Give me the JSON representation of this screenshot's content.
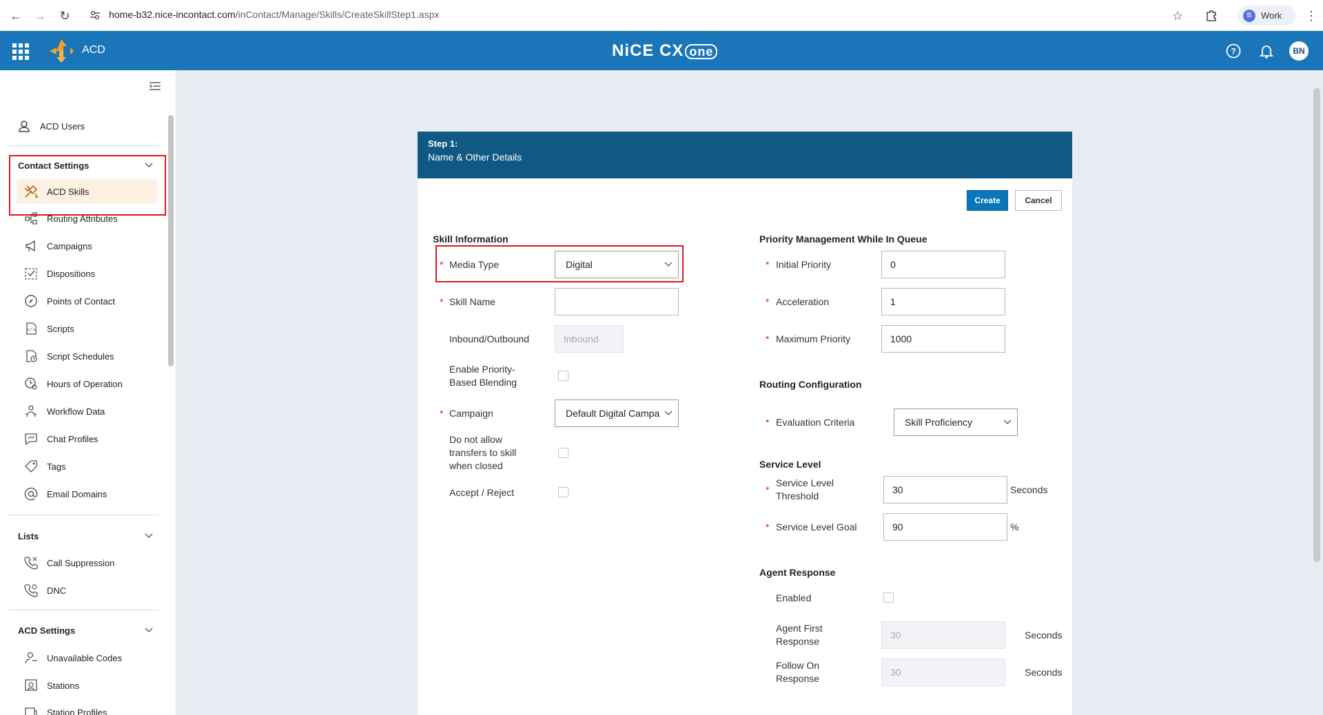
{
  "browser": {
    "url_host": "home-b32.nice-incontact.com",
    "url_path": "/inContact/Manage/Skills/CreateSkillStep1.aspx",
    "profile_initial": "B",
    "profile_label": "Work"
  },
  "header": {
    "app_name": "ACD",
    "brand_main": "NiCE CX",
    "brand_badge": "one",
    "user_initials": "BN"
  },
  "sidebar": {
    "acd_users": "ACD Users",
    "contact_settings": "Contact Settings",
    "items": [
      {
        "label": "ACD Skills",
        "icon": "skills-icon"
      },
      {
        "label": "Routing Attributes",
        "icon": "routing-icon"
      },
      {
        "label": "Campaigns",
        "icon": "megaphone-icon"
      },
      {
        "label": "Dispositions",
        "icon": "dispositions-icon"
      },
      {
        "label": "Points of Contact",
        "icon": "compass-icon"
      },
      {
        "label": "Scripts",
        "icon": "script-icon"
      },
      {
        "label": "Script Schedules",
        "icon": "script-schedule-icon"
      },
      {
        "label": "Hours of Operation",
        "icon": "clock-icon"
      },
      {
        "label": "Workflow Data",
        "icon": "workflow-icon"
      },
      {
        "label": "Chat Profiles",
        "icon": "chat-icon"
      },
      {
        "label": "Tags",
        "icon": "tag-icon"
      },
      {
        "label": "Email Domains",
        "icon": "at-icon"
      }
    ],
    "lists": "Lists",
    "lists_items": [
      {
        "label": "Call Suppression",
        "icon": "phone-off-icon"
      },
      {
        "label": "DNC",
        "icon": "phone-block-icon"
      }
    ],
    "acd_settings": "ACD Settings",
    "acd_settings_items": [
      {
        "label": "Unavailable Codes",
        "icon": "user-code-icon"
      },
      {
        "label": "Stations",
        "icon": "station-icon"
      },
      {
        "label": "Station Profiles",
        "icon": "station-profile-icon"
      }
    ]
  },
  "form": {
    "step": "Step 1:",
    "step_title": "Name & Other Details",
    "create": "Create",
    "cancel": "Cancel",
    "skill_info": {
      "title": "Skill Information",
      "media_type_label": "Media Type",
      "media_type_value": "Digital",
      "skill_name_label": "Skill Name",
      "skill_name_value": "",
      "inbound_outbound_label": "Inbound/Outbound",
      "inbound_outbound_value": "Inbound",
      "blending_label_1": "Enable Priority-",
      "blending_label_2": "Based Blending",
      "campaign_label": "Campaign",
      "campaign_value": "Default Digital Campa",
      "no_transfer_1": "Do not allow",
      "no_transfer_2": "transfers to skill",
      "no_transfer_3": "when closed",
      "accept_reject_label": "Accept / Reject"
    },
    "priority": {
      "title": "Priority Management While In Queue",
      "initial_label": "Initial Priority",
      "initial_value": "0",
      "accel_label": "Acceleration",
      "accel_value": "1",
      "max_label": "Maximum Priority",
      "max_value": "1000"
    },
    "routing": {
      "title": "Routing Configuration",
      "criteria_label": "Evaluation Criteria",
      "criteria_value": "Skill Proficiency"
    },
    "service": {
      "title": "Service Level",
      "threshold_label_1": "Service Level",
      "threshold_label_2": "Threshold",
      "threshold_value": "30",
      "threshold_unit": "Seconds",
      "goal_label": "Service Level Goal",
      "goal_value": "90",
      "goal_unit": "%"
    },
    "agent": {
      "title": "Agent Response",
      "enabled_label": "Enabled",
      "first_label_1": "Agent First",
      "first_label_2": "Response",
      "first_value": "30",
      "first_unit": "Seconds",
      "follow_label_1": "Follow On",
      "follow_label_2": "Response",
      "follow_value": "30",
      "follow_unit": "Seconds"
    }
  }
}
